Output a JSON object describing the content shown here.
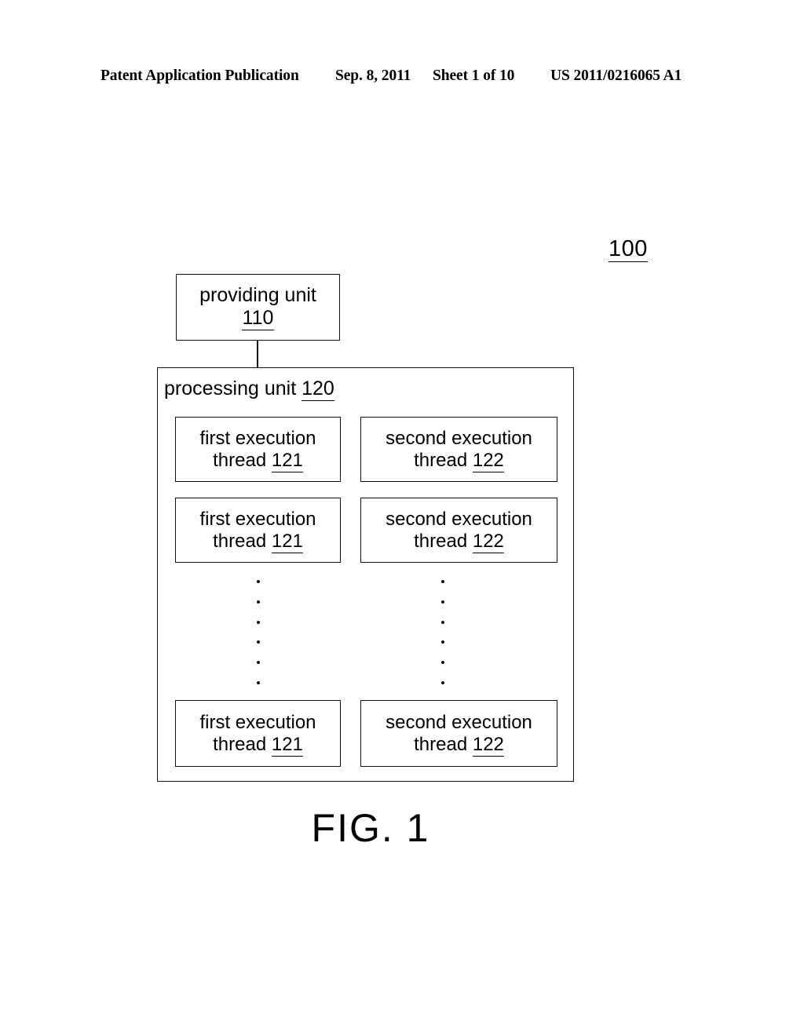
{
  "header": {
    "publication": "Patent Application Publication",
    "date": "Sep. 8, 2011",
    "sheet": "Sheet 1 of 10",
    "patent_number": "US 2011/0216065 A1"
  },
  "figure": {
    "system_reference": "100",
    "caption": "FIG. 1",
    "providing_unit": {
      "label": "providing unit",
      "reference": "110"
    },
    "processing_unit": {
      "label": "processing unit",
      "reference": "120",
      "rows": [
        {
          "left": {
            "line1": "first execution",
            "line2": "thread",
            "reference": "121"
          },
          "right": {
            "line1": "second execution",
            "line2": "thread",
            "reference": "122"
          }
        },
        {
          "left": {
            "line1": "first execution",
            "line2": "thread",
            "reference": "121"
          },
          "right": {
            "line1": "second execution",
            "line2": "thread",
            "reference": "122"
          }
        },
        {
          "left": {
            "line1": "first execution",
            "line2": "thread",
            "reference": "121"
          },
          "right": {
            "line1": "second execution",
            "line2": "thread",
            "reference": "122"
          }
        }
      ],
      "ellipsis_dot_count": 6
    }
  },
  "colors": {
    "ink": "#111111",
    "paper": "#ffffff"
  }
}
